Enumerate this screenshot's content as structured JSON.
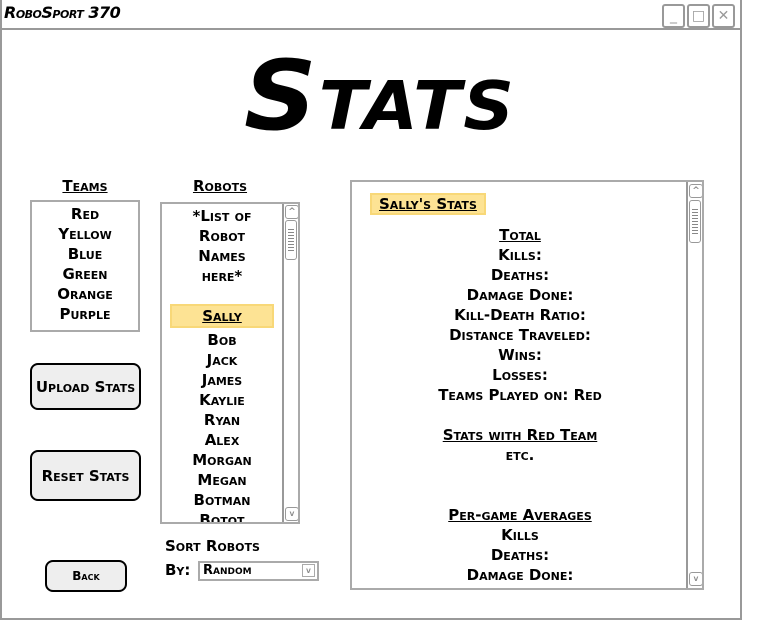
{
  "window": {
    "title": "RoboSport 370",
    "min": "_",
    "max": "□",
    "close": "✕"
  },
  "heading": "Stats",
  "teams": {
    "label": "Teams",
    "items": [
      "Red",
      "Yellow",
      "Blue",
      "Green",
      "Orange",
      "Purple"
    ]
  },
  "robots": {
    "label": "Robots",
    "placeholder": [
      "*List of",
      "Robot",
      "Names",
      "here*"
    ],
    "selected": "Sally",
    "items": [
      "Bob",
      "Jack",
      "James",
      "Kaylie",
      "Ryan",
      "Alex",
      "Morgan",
      "Megan",
      "Botman",
      "Botot"
    ]
  },
  "buttons": {
    "upload": "Upload Stats",
    "reset": "Reset Stats",
    "back": "Back"
  },
  "sort": {
    "label": "Sort Robots",
    "by": "By:",
    "value": "Random"
  },
  "stats": {
    "title": "Sally's Stats",
    "total_heading": "Total",
    "total": [
      "Kills:",
      "Deaths:",
      "Damage Done:",
      "Kill-Death Ratio:",
      "Distance Traveled:",
      "Wins:",
      "Losses:",
      "Teams Played on: Red"
    ],
    "team_heading": "Stats with Red Team",
    "team_etc": "etc.",
    "avg_heading": "Per-game Averages",
    "avg": [
      "Kills",
      "Deaths:",
      "Damage Done:"
    ]
  }
}
